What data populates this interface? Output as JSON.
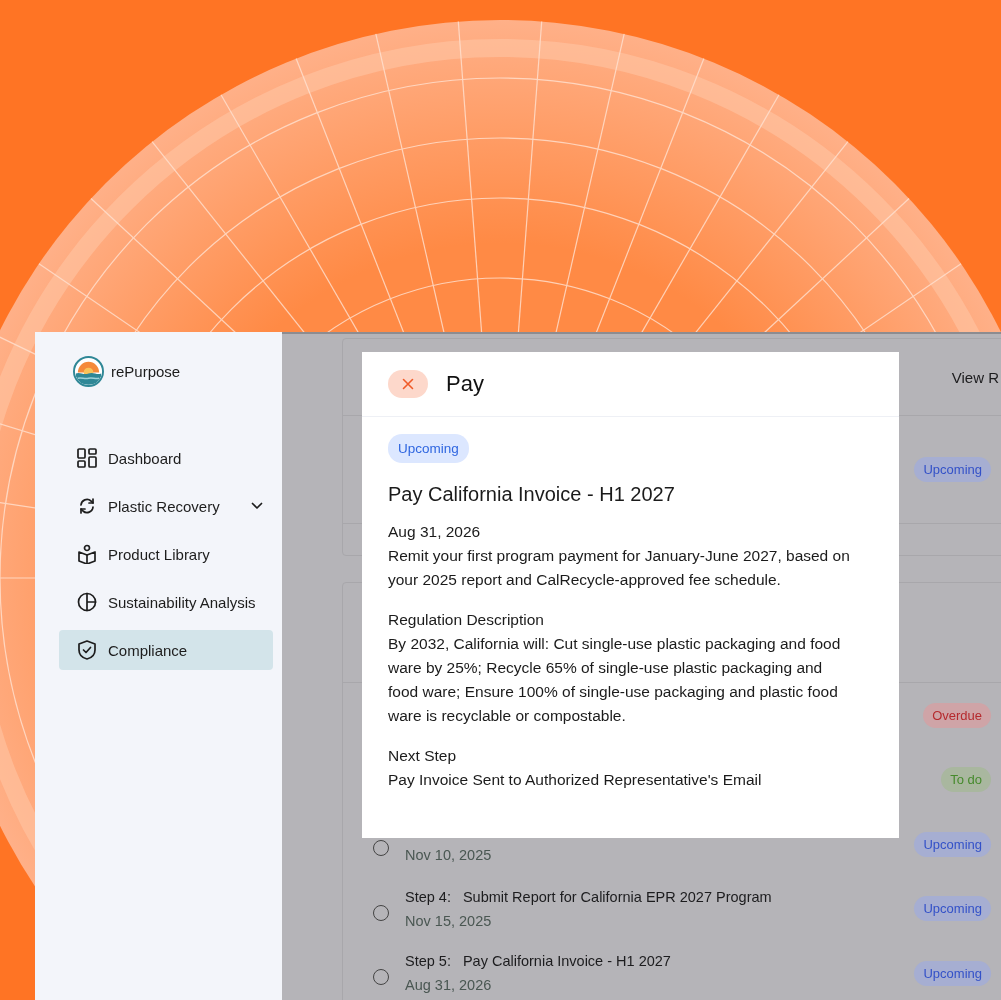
{
  "brand": {
    "name": "rePurpose"
  },
  "sidebar": {
    "items": [
      {
        "label": "Dashboard",
        "has_submenu": false,
        "selected": false
      },
      {
        "label": "Plastic Recovery",
        "has_submenu": true,
        "selected": false
      },
      {
        "label": "Product Library",
        "has_submenu": false,
        "selected": false
      },
      {
        "label": "Sustainability Analysis",
        "has_submenu": false,
        "selected": false
      },
      {
        "label": "Compliance",
        "has_submenu": false,
        "selected": true
      }
    ]
  },
  "task_cards": [
    {
      "header_action": "View R",
      "rows": [
        {
          "badge": {
            "label": "Upcoming",
            "kind": "upcoming"
          }
        }
      ]
    },
    {
      "rows": [
        {
          "badge": {
            "label": "Overdue",
            "kind": "overdue"
          }
        },
        {
          "badge": {
            "label": "To do",
            "kind": "todo"
          }
        },
        {
          "date": "Nov 10, 2025",
          "checked": false,
          "badge": {
            "label": "Upcoming",
            "kind": "upcoming"
          }
        },
        {
          "step": "Step 4:",
          "title": "Submit Report for California EPR 2027 Program",
          "date": "Nov 15, 2025",
          "checked": false,
          "badge": {
            "label": "Upcoming",
            "kind": "upcoming"
          }
        },
        {
          "step": "Step 5:",
          "title": "Pay California Invoice - H1 2027",
          "date": "Aug 31, 2026",
          "checked": false,
          "badge": {
            "label": "Upcoming",
            "kind": "upcoming"
          }
        }
      ]
    }
  ],
  "modal": {
    "title": "Pay",
    "badge": {
      "label": "Upcoming",
      "kind": "upcoming"
    },
    "heading": "Pay California Invoice - H1 2027",
    "date": "Aug 31, 2026",
    "description": "Remit your first program payment for January-June 2027, based on your 2025 report and CalRecycle-approved fee schedule.",
    "sections": [
      {
        "label": "Regulation Description",
        "text": "By 2032, California will: Cut single-use plastic packaging and food ware by 25%; Recycle 65% of single-use plastic packaging and food ware; Ensure 100% of single-use packaging and plastic food ware is recyclable or compostable."
      },
      {
        "label": "Next Step",
        "text": "Pay Invoice Sent to Authorized Representative's Email"
      }
    ]
  }
}
